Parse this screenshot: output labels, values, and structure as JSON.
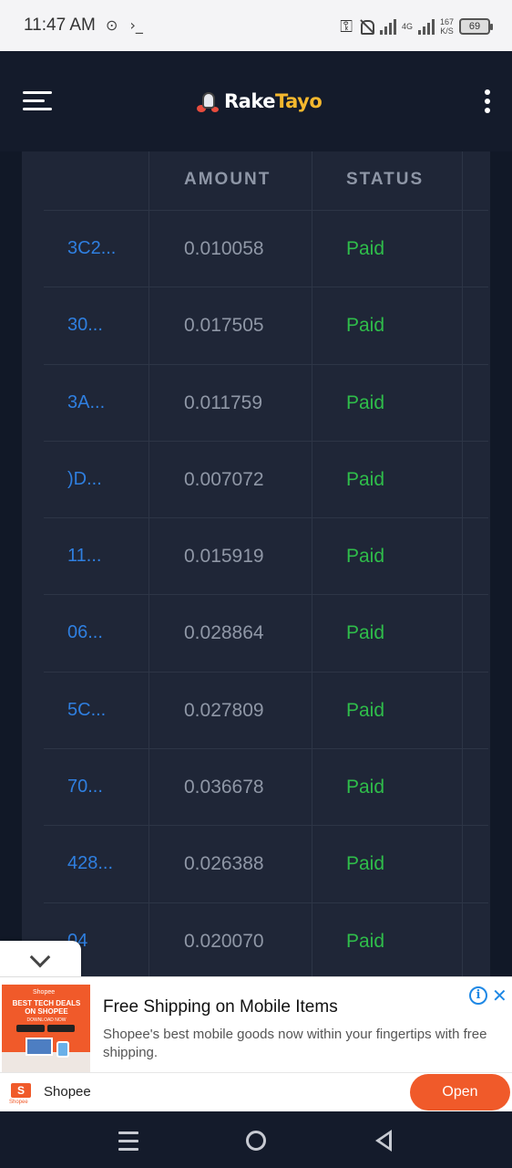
{
  "status_bar": {
    "time": "11:47 AM",
    "left_icons": [
      "⊙",
      "›_"
    ],
    "net": "4G",
    "speed_value": "167",
    "speed_unit": "K/S",
    "battery": "69"
  },
  "app_bar": {
    "logo_part1": "Rake",
    "logo_part2": "Tayo"
  },
  "table": {
    "headers": {
      "amount": "AMOUNT",
      "status": "STATUS"
    },
    "rows": [
      {
        "id": "3C2...",
        "amount": "0.010058",
        "status": "Paid"
      },
      {
        "id": "30...",
        "amount": "0.017505",
        "status": "Paid"
      },
      {
        "id": "3A...",
        "amount": "0.011759",
        "status": "Paid"
      },
      {
        "id": ")D...",
        "amount": "0.007072",
        "status": "Paid"
      },
      {
        "id": "11...",
        "amount": "0.015919",
        "status": "Paid"
      },
      {
        "id": "06...",
        "amount": "0.028864",
        "status": "Paid"
      },
      {
        "id": "5C...",
        "amount": "0.027809",
        "status": "Paid"
      },
      {
        "id": "70...",
        "amount": "0.036678",
        "status": "Paid"
      },
      {
        "id": "428...",
        "amount": "0.026388",
        "status": "Paid"
      },
      {
        "id": "04",
        "amount": "0.020070",
        "status": "Paid"
      }
    ]
  },
  "ad": {
    "image_brand": "Shopee",
    "image_headline": "BEST TECH DEALS ON SHOPEE",
    "image_subline": "DOWNLOAD NOW",
    "title": "Free Shipping on Mobile Items",
    "description": "Shopee's best mobile goods now within your fingertips with free shipping.",
    "advertiser": "Shopee",
    "logo_letter": "S",
    "logo_label": "Shopee",
    "cta": "Open",
    "info_glyph": "i",
    "close_glyph": "✕"
  },
  "colors": {
    "id_link": "#2f7fe0",
    "amount": "#8f97a6",
    "paid": "#2fbd4a",
    "logo_accent": "#f5b82e",
    "cta": "#f05a2a"
  }
}
